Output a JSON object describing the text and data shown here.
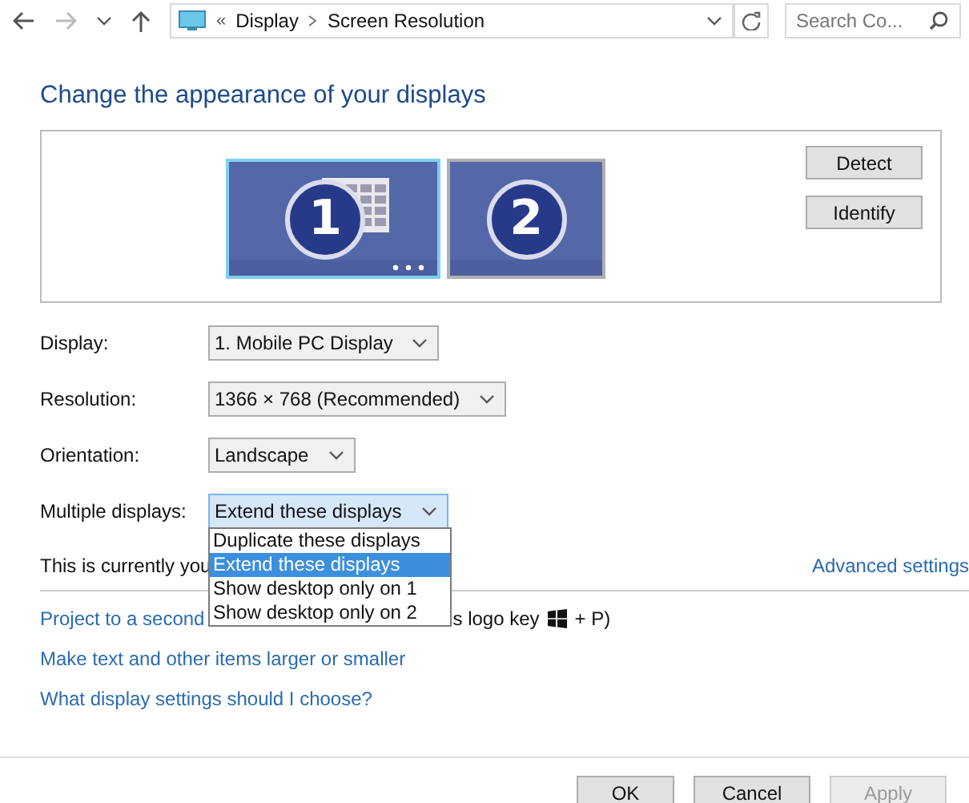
{
  "nav": {
    "breadcrumb": [
      "Display",
      "Screen Resolution"
    ],
    "overflow": "«",
    "search": {
      "placeholder": "Search Co..."
    }
  },
  "title": "Change the appearance of your displays",
  "monitors": [
    {
      "number": "1",
      "selected": true
    },
    {
      "number": "2",
      "selected": false
    }
  ],
  "side_buttons": [
    "Detect",
    "Identify"
  ],
  "settings": [
    {
      "label": "Display:",
      "value": "1. Mobile PC Display",
      "open": false
    },
    {
      "label": "Resolution:",
      "value": "1366 × 768 (Recommended)",
      "open": false
    },
    {
      "label": "Orientation:",
      "value": "Landscape",
      "open": false
    },
    {
      "label": "Multiple displays:",
      "value": "Extend these displays",
      "open": true,
      "options": [
        {
          "label": "Duplicate these displays",
          "selected": false
        },
        {
          "label": "Extend these displays",
          "selected": true
        },
        {
          "label": "Show desktop only on 1",
          "selected": false
        },
        {
          "label": "Show desktop only on 2",
          "selected": false
        }
      ]
    }
  ],
  "status_text": "This is currently you",
  "advanced_link": "Advanced settings",
  "project_line": {
    "link": "Project to a second",
    "tail": "s logo key",
    "suffix": "+ P)"
  },
  "links": [
    "Make text and other items larger or smaller",
    "What display settings should I choose?"
  ],
  "buttons": [
    {
      "label": "OK",
      "disabled": false
    },
    {
      "label": "Cancel",
      "disabled": false
    },
    {
      "label": "Apply",
      "disabled": true
    }
  ]
}
